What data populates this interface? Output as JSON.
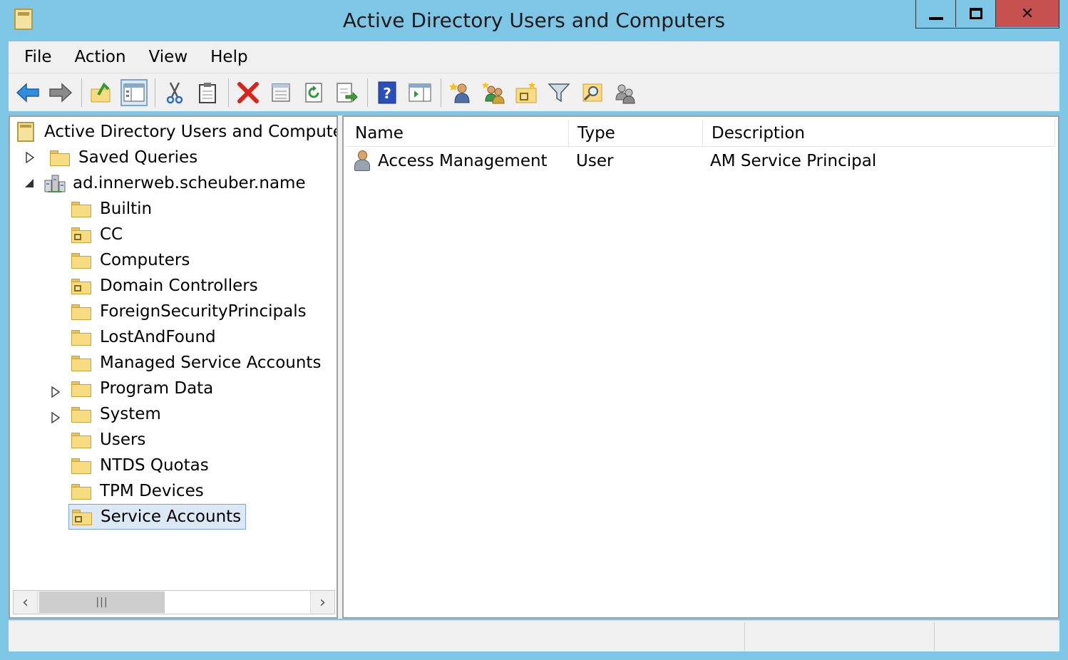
{
  "window": {
    "title": "Active Directory Users and Computers"
  },
  "menu": [
    {
      "label": "File"
    },
    {
      "label": "Action"
    },
    {
      "label": "View"
    },
    {
      "label": "Help"
    }
  ],
  "toolbar": [
    {
      "name": "back-arrow-icon"
    },
    {
      "name": "forward-arrow-icon"
    },
    {
      "name": "up-one-level-icon"
    },
    {
      "name": "show-hide-console-tree-icon"
    },
    {
      "name": "cut-icon"
    },
    {
      "name": "paste-icon"
    },
    {
      "name": "delete-icon"
    },
    {
      "name": "properties-icon"
    },
    {
      "name": "refresh-icon"
    },
    {
      "name": "export-list-icon"
    },
    {
      "name": "help-icon"
    },
    {
      "name": "show-action-pane-icon"
    },
    {
      "name": "new-user-icon"
    },
    {
      "name": "new-group-icon"
    },
    {
      "name": "new-ou-icon"
    },
    {
      "name": "filter-icon"
    },
    {
      "name": "find-icon"
    },
    {
      "name": "add-to-group-icon"
    }
  ],
  "tree": {
    "root": "Active Directory Users and Computers",
    "saved_queries": "Saved Queries",
    "domain": "ad.innerweb.scheuber.name",
    "children": [
      {
        "label": "Builtin",
        "ou": false,
        "expandable": false
      },
      {
        "label": "CC",
        "ou": true,
        "expandable": false
      },
      {
        "label": "Computers",
        "ou": false,
        "expandable": false
      },
      {
        "label": "Domain Controllers",
        "ou": true,
        "expandable": false
      },
      {
        "label": "ForeignSecurityPrincipals",
        "ou": false,
        "expandable": false
      },
      {
        "label": "LostAndFound",
        "ou": false,
        "expandable": false
      },
      {
        "label": "Managed Service Accounts",
        "ou": false,
        "expandable": false
      },
      {
        "label": "Program Data",
        "ou": false,
        "expandable": true
      },
      {
        "label": "System",
        "ou": false,
        "expandable": true
      },
      {
        "label": "Users",
        "ou": false,
        "expandable": false
      },
      {
        "label": "NTDS Quotas",
        "ou": false,
        "expandable": false
      },
      {
        "label": "TPM Devices",
        "ou": false,
        "expandable": false
      },
      {
        "label": "Service Accounts",
        "ou": true,
        "expandable": false,
        "selected": true
      }
    ]
  },
  "list": {
    "columns": [
      "Name",
      "Type",
      "Description"
    ],
    "rows": [
      {
        "name": "Access Management",
        "type": "User",
        "description": "AM Service Principal"
      }
    ]
  },
  "colors": {
    "titlebar": "#7ec6e6",
    "close_button": "#c75050",
    "selection": "#dce8f5",
    "selection_border": "#7aa6d6"
  }
}
